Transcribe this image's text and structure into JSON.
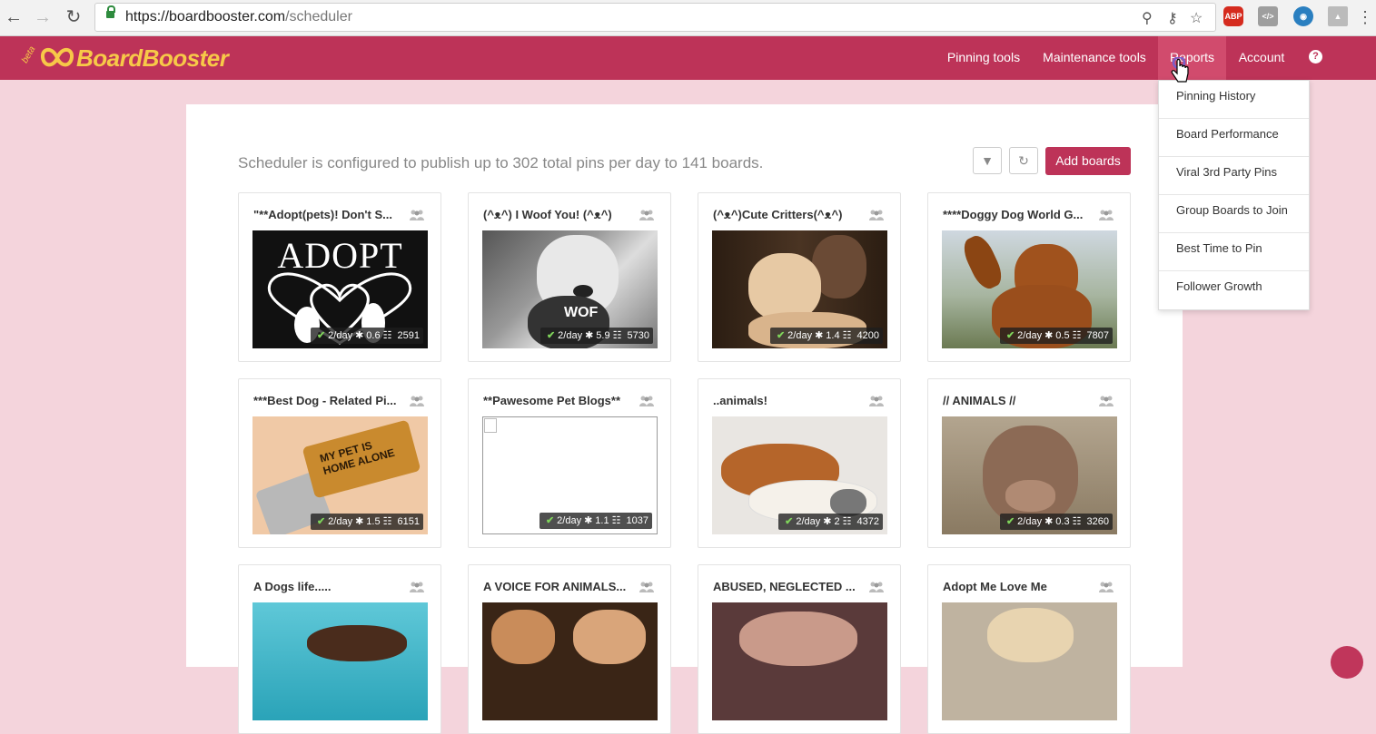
{
  "browser": {
    "url_host": "https://boardbooster.com",
    "url_path": "/scheduler",
    "extensions": [
      "zoom-icon",
      "key-icon",
      "star-icon",
      "adblock-icon",
      "code-icon",
      "eye-extension-icon",
      "drive-icon",
      "menu-icon"
    ],
    "adblock_label": "ABP"
  },
  "header": {
    "beta": "beta",
    "logo_text": "BoardBooster",
    "nav": [
      "Pinning tools",
      "Maintenance tools",
      "Reports",
      "Account"
    ],
    "help": "?"
  },
  "reports_menu": [
    "Pinning History",
    "Board Performance",
    "Viral 3rd Party Pins",
    "Group Boards to Join",
    "Best Time to Pin",
    "Follower Growth"
  ],
  "summary": "Scheduler is configured to publish up to 302 total pins per day to 141 boards.",
  "add_boards": "Add boards",
  "boards": [
    {
      "title": "\"**Adopt(pets)! Don't S...",
      "per_day": "2/day",
      "score": "0.6",
      "followers": "2591"
    },
    {
      "title": "(^ᴥ^) I Woof You! (^ᴥ^)",
      "per_day": "2/day",
      "score": "5.9",
      "followers": "5730"
    },
    {
      "title": "(^ᴥ^)Cute Critters(^ᴥ^)",
      "per_day": "2/day",
      "score": "1.4",
      "followers": "4200"
    },
    {
      "title": "****Doggy Dog World G...",
      "per_day": "2/day",
      "score": "0.5",
      "followers": "7807"
    },
    {
      "title": "***Best Dog - Related Pi...",
      "per_day": "2/day",
      "score": "1.5",
      "followers": "6151"
    },
    {
      "title": "**Pawesome Pet Blogs**",
      "per_day": "2/day",
      "score": "1.1",
      "followers": "1037"
    },
    {
      "title": "..animals!",
      "per_day": "2/day",
      "score": "2",
      "followers": "4372"
    },
    {
      "title": "// ANIMALS //",
      "per_day": "2/day",
      "score": "0.3",
      "followers": "3260"
    },
    {
      "title": "A Dogs life.....",
      "per_day": "",
      "score": "",
      "followers": ""
    },
    {
      "title": "A VOICE FOR ANIMALS...",
      "per_day": "",
      "score": "",
      "followers": ""
    },
    {
      "title": "ABUSED, NEGLECTED ...",
      "per_day": "",
      "score": "",
      "followers": ""
    },
    {
      "title": "Adopt Me Love Me",
      "per_day": "",
      "score": "",
      "followers": ""
    }
  ],
  "image_texts": {
    "adopt": "ADOPT",
    "woof": "WOF",
    "tag_line1": "MY PET IS",
    "tag_line2": "HOME ALONE"
  },
  "colors": {
    "brand": "#bd3358",
    "logo": "#f7c948",
    "page_bg": "#f4d4dc",
    "check": "#7fd35b"
  }
}
